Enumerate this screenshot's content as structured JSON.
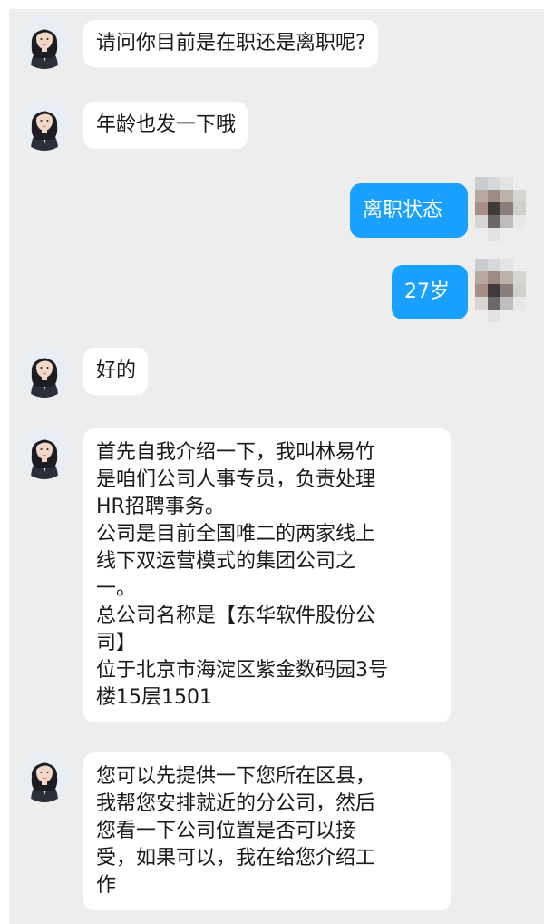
{
  "messages": [
    {
      "sender": "contact",
      "text": "请问你目前是在职还是离职呢?"
    },
    {
      "sender": "contact",
      "text": "年龄也发一下哦"
    },
    {
      "sender": "self",
      "text": "离职状态"
    },
    {
      "sender": "self",
      "text": "27岁"
    },
    {
      "sender": "contact",
      "text": "好的"
    },
    {
      "sender": "contact",
      "lines": [
        "首先自我介绍一下，我叫林易竹",
        "是咱们公司人事专员，负责处理",
        "HR招聘事务。",
        "公司是目前全国唯二的两家线上",
        "线下双运营模式的集团公司之",
        "一。",
        "总公司名称是【东华软件股份公",
        "司】",
        "位于北京市海淀区紫金数码园3号",
        "楼15层1501"
      ]
    },
    {
      "sender": "contact",
      "lines": [
        "您可以先提供一下您所在区县，",
        "我帮您安排就近的分公司，然后",
        "您看一下公司位置是否可以接",
        "受，如果可以，我在给您介绍工",
        "作"
      ]
    }
  ],
  "colors": {
    "background": "#ededed",
    "incoming_bubble": "#ffffff",
    "outgoing_bubble": "#1aa0ff"
  },
  "icons": {
    "contact_avatar": "woman-portrait-avatar",
    "self_avatar": "pixelated-avatar"
  }
}
